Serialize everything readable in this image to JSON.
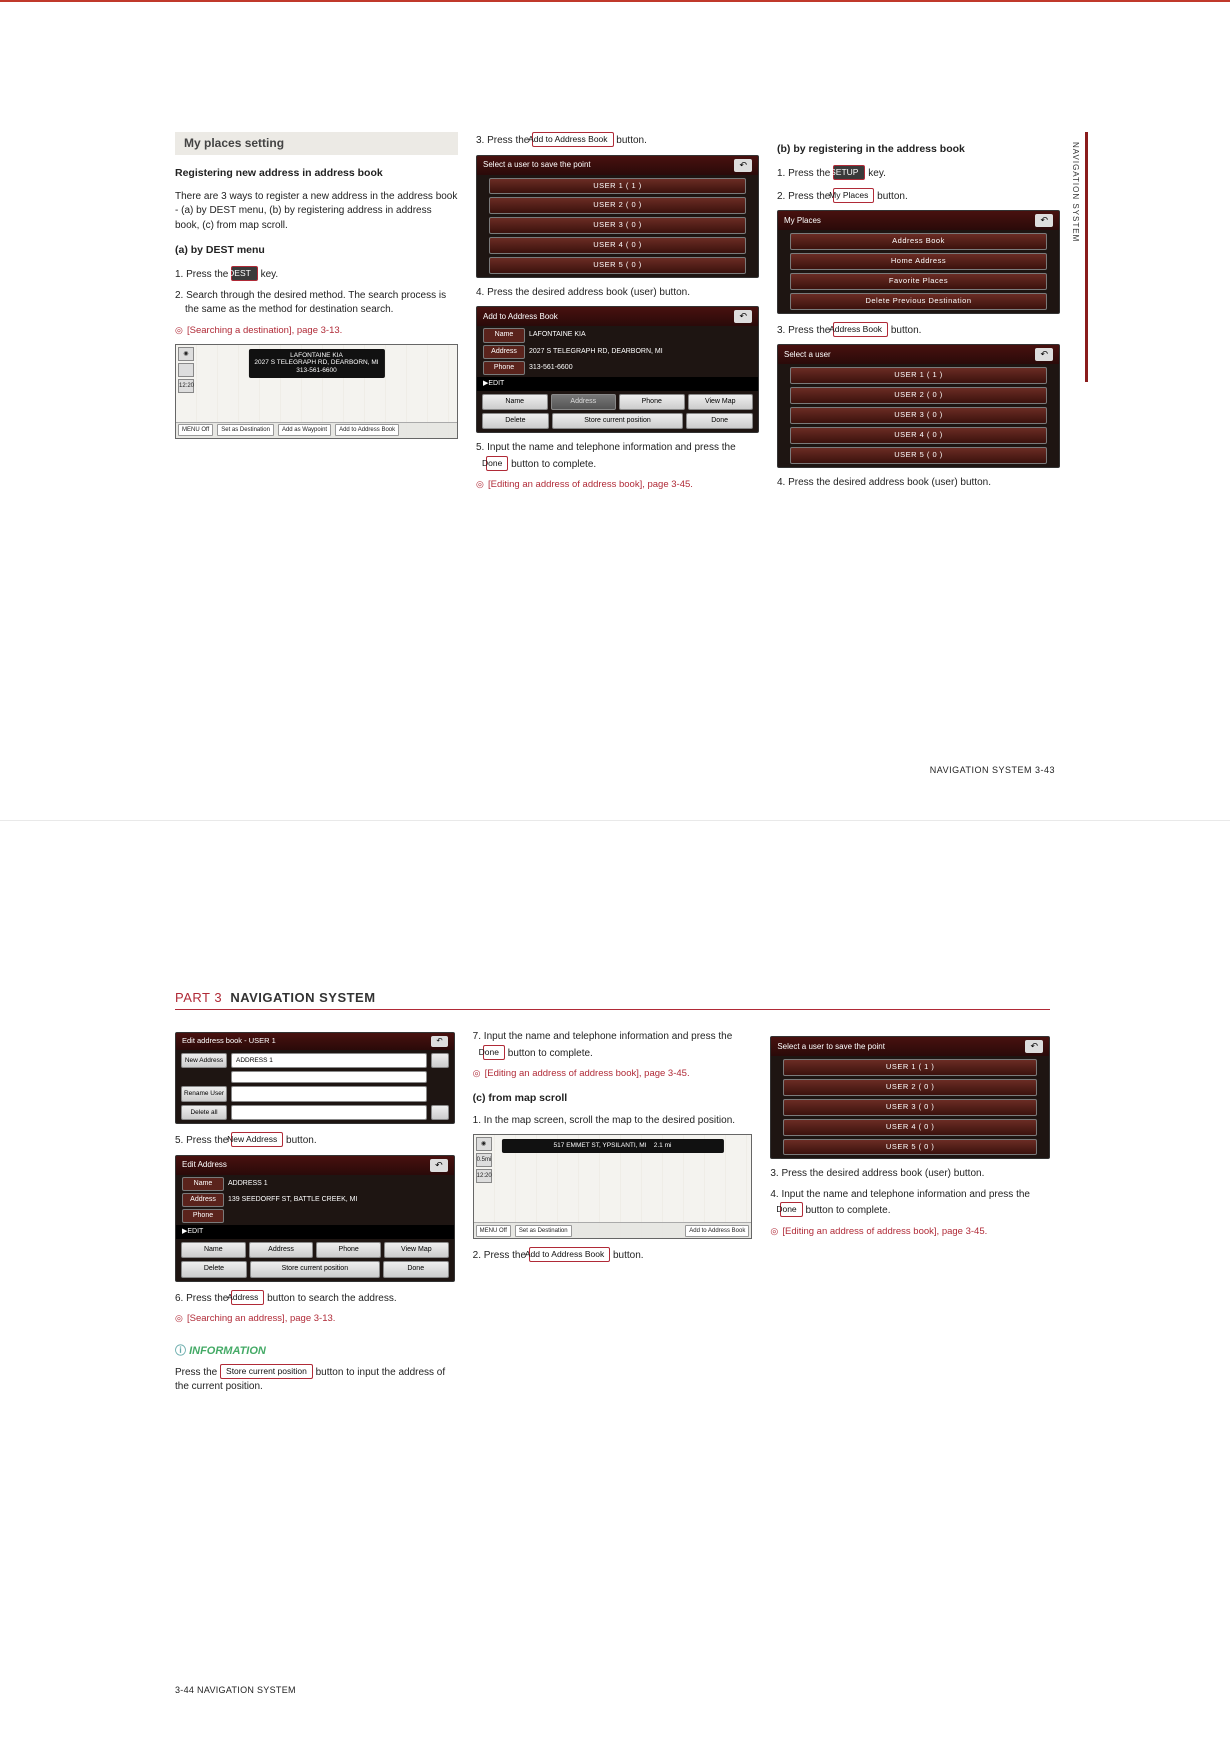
{
  "page1": {
    "sectionTitle": "My places setting",
    "col1": {
      "sub1": "Registering new address in address book",
      "intro": "There are 3 ways to register a new address in the address book - (a) by DEST menu, (b) by registering address in address book, (c) from map scroll.",
      "subA": "(a) by DEST menu",
      "s1a": "1. Press the ",
      "s1b": " key.",
      "key1": "DEST",
      "s2": "2. Search through the desired method. The search process is the same as the method for destination search.",
      "xref1": "[Searching a destination], page 3-13.",
      "map": {
        "name": "LAFONTAINE KIA",
        "addr": "2027 S TELEGRAPH RD, DEARBORN, MI",
        "phone": "313-561-6600",
        "btn1": "MENU Off",
        "btn2": "Set as Destination",
        "btn3": "Add as Waypoint",
        "btn4": "Add to Address Book"
      }
    },
    "col2": {
      "s3a": "3. Press the ",
      "s3b": " button.",
      "key3": "Add to Address Book",
      "devListTitle": "Select a user to save the point",
      "users": [
        "USER 1 ( 1 )",
        "USER 2 ( 0 )",
        "USER 3 ( 0 )",
        "USER 4 ( 0 )",
        "USER 5 ( 0 )"
      ],
      "s4": "4. Press the desired address book (user) button.",
      "addTitle": "Add to Address Book",
      "fields": {
        "nameLab": "Name",
        "name": "LAFONTAINE KIA",
        "addrLab": "Address",
        "addr": "2027 S TELEGRAPH RD, DEARBORN, MI",
        "phoneLab": "Phone",
        "phone": "313-561-6600"
      },
      "editLab": "▶EDIT",
      "btns": {
        "name": "Name",
        "address": "Address",
        "phone": "Phone",
        "view": "View Map",
        "del": "Delete",
        "store": "Store current position",
        "done": "Done"
      },
      "s5a": "5. Input the name and telephone information and press the ",
      "s5b": " button to complete.",
      "key5": "Done",
      "xref2": "[Editing an address of address book], page 3-45."
    },
    "col3": {
      "subB": "(b) by registering in the address book",
      "s1a": "1. Press the ",
      "s1b": " key.",
      "key1": "SETUP",
      "s2a": "2. Press the ",
      "s2b": " button.",
      "key2": "My Places",
      "myplacesTitle": "My Places",
      "mpItems": [
        "Address Book",
        "Home Address",
        "Favorite Places",
        "Delete Previous Destination"
      ],
      "s3a": "3. Press the ",
      "s3b": " button.",
      "key3": "Address Book",
      "selectUser": "Select a user",
      "users": [
        "USER 1 ( 1 )",
        "USER 2 ( 0 )",
        "USER 3 ( 0 )",
        "USER 4 ( 0 )",
        "USER 5 ( 0 )"
      ],
      "s4": "4. Press the desired address book (user) button."
    },
    "footer": "NAVIGATION SYSTEM   3-43",
    "sideTab": "NAVIGATION SYSTEM"
  },
  "page2": {
    "partLabel": "PART 3",
    "partTitle": "NAVIGATION SYSTEM",
    "col1": {
      "ebTitle": "Edit address book - USER 1",
      "ebNew": "New Address",
      "ebAddr": "ADDRESS 1",
      "ebRename": "Rename User",
      "ebDel": "Delete all",
      "s5a": "5. Press the ",
      "s5b": " button.",
      "key5": "New Address",
      "eaTitle": "Edit Address",
      "eaFields": {
        "nameLab": "Name",
        "name": "ADDRESS 1",
        "addrLab": "Address",
        "addr": "139 SEEDORFF ST, BATTLE CREEK, MI",
        "phoneLab": "Phone"
      },
      "editLab": "▶EDIT",
      "btns": {
        "name": "Name",
        "address": "Address",
        "phone": "Phone",
        "view": "View Map",
        "del": "Delete",
        "store": "Store current position",
        "done": "Done"
      },
      "s6a": "6. Press the ",
      "s6b": " button to search the address.",
      "key6": "Address",
      "xref": "[Searching an address], page 3-13.",
      "infoTitle": "INFORMATION",
      "infoA": "Press the ",
      "infoB": " button to input the address of the current position.",
      "infoKey": "Store current position"
    },
    "col2": {
      "s7a": "7. Input the name and telephone information and press the ",
      "s7b": " button to complete.",
      "key7": "Done",
      "xref1": "[Editing an address of address book], page 3-45.",
      "subC": "(c) from map scroll",
      "s1": "1. In the map screen, scroll the map to the desired position.",
      "mapAddr": "517 EMMET ST, YPSILANTI, MI",
      "mapDist": "2.1 mi",
      "mapBtns": {
        "menu": "MENU Off",
        "set": "Set as Destination",
        "add": "Add to Address Book"
      },
      "s2a": "2. Press the ",
      "s2b": " button.",
      "key2": "Add to Address Book"
    },
    "col3": {
      "selTitle": "Select a user to save the point",
      "users": [
        "USER 1 ( 1 )",
        "USER 2 ( 0 )",
        "USER 3 ( 0 )",
        "USER 4 ( 0 )",
        "USER 5 ( 0 )"
      ],
      "s3": "3. Press the desired address book (user) button.",
      "s4a": "4. Input the name and telephone information and press the ",
      "s4b": " button to complete.",
      "key4": "Done",
      "xref": "[Editing an address of address book], page 3-45."
    },
    "footer": "3-44   NAVIGATION SYSTEM"
  }
}
